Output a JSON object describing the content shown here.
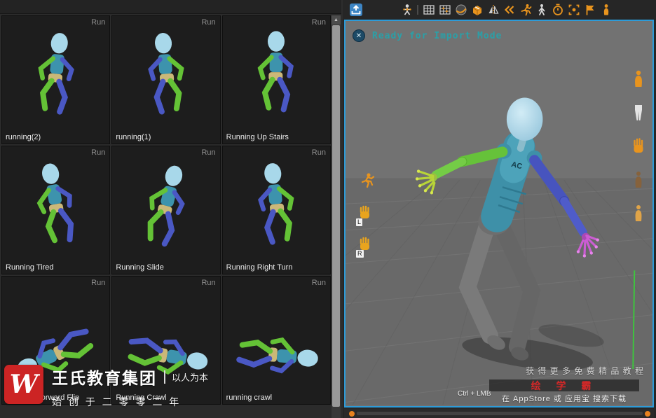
{
  "colors": {
    "viewport_border": "#2d9bd8",
    "accent_orange": "#e8941e",
    "status_teal": "#2aa0a8",
    "brand_red": "#d42828",
    "import_blue": "#3d85c4"
  },
  "left_panel": {
    "scroll_up_glyph": "▲",
    "items": [
      {
        "label": "running(2)",
        "badge": "Run"
      },
      {
        "label": "running(1)",
        "badge": "Run"
      },
      {
        "label": "Running Up Stairs",
        "badge": "Run"
      },
      {
        "label": "Running Tired",
        "badge": "Run"
      },
      {
        "label": "Running Slide",
        "badge": "Run"
      },
      {
        "label": "Running Right Turn",
        "badge": "Run"
      },
      {
        "label": "Running Forward Flip",
        "badge": "Run"
      },
      {
        "label": "Running Crawl",
        "badge": "Run"
      },
      {
        "label": "running crawl",
        "badge": "Run"
      }
    ]
  },
  "toolbar": {
    "icons": [
      "import",
      "character-rig",
      "grid",
      "grid-dots",
      "sphere",
      "package",
      "mirror",
      "back-chevrons",
      "run-cycle",
      "walk-cycle",
      "timer",
      "capture-frame",
      "flag",
      "mannequin"
    ]
  },
  "viewport": {
    "status_label": "Ready for Import Mode",
    "status_close_glyph": "✕",
    "chest_label": "AC",
    "hand_left_label": "L",
    "hand_right_label": "R",
    "hint": "Ctrl + LMB",
    "promo": {
      "line1": "获 得 更 多 免 费 精 品 教 程",
      "brand": "绘 学 霸",
      "line2": "在 AppStore 或 应用宝 搜索下载"
    }
  },
  "watermark": {
    "logo_letter": "W",
    "brand": "王氏教育集团",
    "slogan": "以人为本",
    "founded": "始 创 于 二 零 零 二 年"
  }
}
